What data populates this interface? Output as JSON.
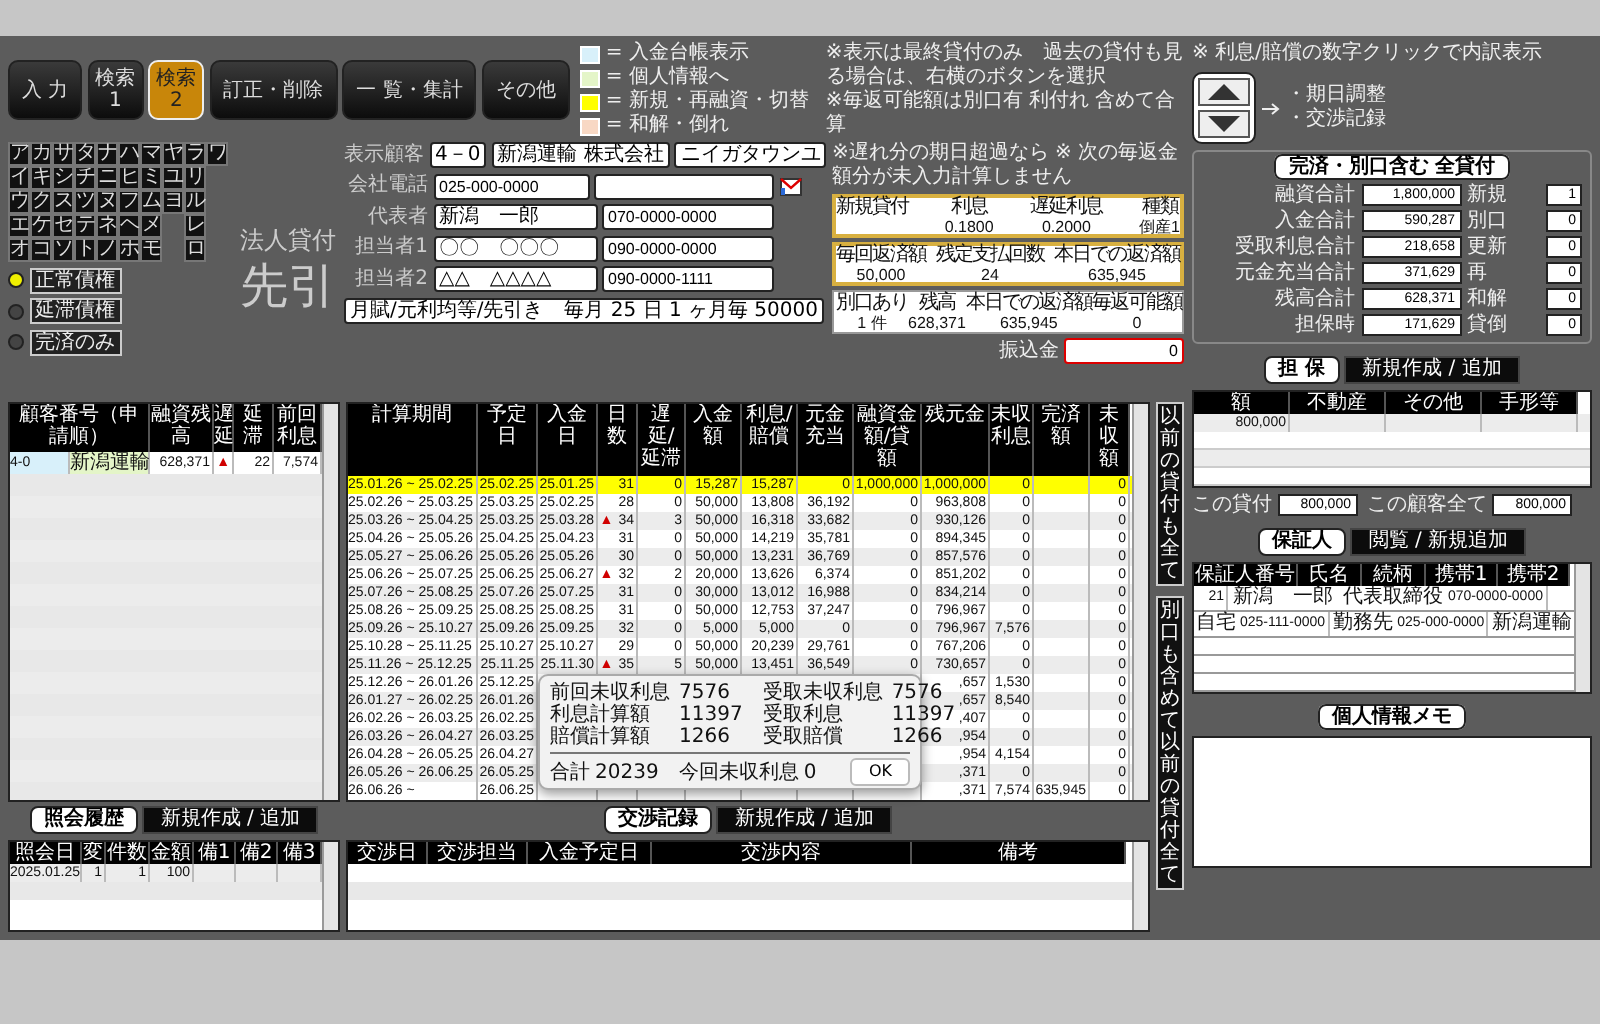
{
  "nav_buttons": [
    {
      "label": "入 力",
      "selected": false
    },
    {
      "label": "検索 1",
      "selected": false
    },
    {
      "label": "検索 2",
      "selected": true
    },
    {
      "label": "訂正・削除",
      "selected": false
    },
    {
      "label": "一 覧・集計",
      "selected": false
    },
    {
      "label": "その他",
      "selected": false
    }
  ],
  "legend": [
    {
      "color": "#d8f0fa",
      "label": "= 入金台帳表示"
    },
    {
      "color": "#e4f5c8",
      "label": "= 個人情報へ"
    },
    {
      "color": "#ffff00",
      "label": "= 新規・再融資・切替"
    },
    {
      "color": "#f8d8c4",
      "label": "= 和解・倒れ"
    }
  ],
  "notes": [
    "※表示は最終貸付のみ　過去の貸付も見る場合は、右横のボタンを選択",
    "※毎返可能額は別口有 利付れ 含めて合算"
  ],
  "detail_note": "※ 利息/賠償の数字クリックで内訳表示",
  "kana_columns": [
    [
      "ア",
      "イ",
      "ウ",
      "エ",
      "オ"
    ],
    [
      "カ",
      "キ",
      "ク",
      "ケ",
      "コ"
    ],
    [
      "サ",
      "シ",
      "ス",
      "セ",
      "ソ"
    ],
    [
      "タ",
      "チ",
      "ツ",
      "テ",
      "ト"
    ],
    [
      "ナ",
      "ニ",
      "ヌ",
      "ネ",
      "ノ"
    ],
    [
      "ハ",
      "ヒ",
      "フ",
      "ヘ",
      "ホ"
    ],
    [
      "マ",
      "ミ",
      "ム",
      "メ",
      "モ"
    ],
    [
      "ヤ",
      "ユ",
      "ヨ"
    ],
    [
      "ラ",
      "リ",
      "ル",
      "レ",
      "ロ"
    ],
    [
      "ワ"
    ]
  ],
  "status_filters": [
    {
      "label": "正常債権",
      "selected": true
    },
    {
      "label": "延滞債権",
      "selected": false
    },
    {
      "label": "完済のみ",
      "selected": false
    }
  ],
  "loan_type": "法人貸付",
  "loan_method": "先引",
  "customer": {
    "display_label": "表示顧客",
    "number": "4－0",
    "name": "新潟運輸 株式会社",
    "kana": "ニイガタウンユ",
    "phone_label": "会社電話",
    "company_phone": "025-000-0000",
    "contacts": [
      {
        "label": "代表者",
        "name": "新潟　一郎",
        "phone": "070-0000-0000"
      },
      {
        "label": "担当者1",
        "name": "〇〇　〇〇〇",
        "phone": "090-0000-0000"
      },
      {
        "label": "担当者2",
        "name": "△△　△△△△",
        "phone": "090-0000-1111"
      }
    ],
    "terms": "月賦/元利均等/先引き",
    "schedule": "毎月 25 日 1 ヶ月毎 50000"
  },
  "loan_info": {
    "note": "※遅れ分の期日超過なら ※ 次の毎返金額分が未入力計算しません",
    "boxes": [
      {
        "kind": "highlight",
        "cells": [
          {
            "label": "新規貸付"
          },
          {
            "label": "利息",
            "value": "0.1800"
          },
          {
            "label": "遅延利息",
            "value": "0.2000"
          },
          {
            "label": "種類",
            "value": "倒産1"
          }
        ]
      },
      {
        "kind": "highlight",
        "cells": [
          {
            "label": "毎回返済額",
            "value": "50,000"
          },
          {
            "label": "残定支払回数",
            "value": "24"
          },
          {
            "label": "本日での返済額",
            "value": "635,945"
          }
        ]
      },
      {
        "kind": "plain",
        "cells": [
          {
            "label": "別口あり",
            "value": "1 件"
          },
          {
            "label": "残高",
            "value": "628,371"
          },
          {
            "label": "本日での返済額",
            "value": "635,945"
          },
          {
            "label": "毎返可能額",
            "value": "0"
          }
        ]
      }
    ],
    "transfer": {
      "label": "振込金",
      "value": "0"
    }
  },
  "jump_links": [
    "・期日調整",
    "・交渉記録"
  ],
  "summary": {
    "title": "完済・別口含む 全貸付",
    "totals": [
      {
        "label": "融資合計",
        "value": "1,800,000"
      },
      {
        "label": "入金合計",
        "value": "590,287"
      },
      {
        "label": "受取利息合計",
        "value": "218,658"
      },
      {
        "label": "元金充当合計",
        "value": "371,629"
      },
      {
        "label": "残高合計",
        "value": "628,371"
      },
      {
        "label": "担保時",
        "value": "171,629"
      }
    ],
    "counts": [
      {
        "label": "新規",
        "value": "1"
      },
      {
        "label": "別口",
        "value": "0"
      },
      {
        "label": "更新",
        "value": "0"
      },
      {
        "label": "再",
        "value": "0"
      },
      {
        "label": "和解",
        "value": "0"
      },
      {
        "label": "貸倒",
        "value": "0"
      }
    ]
  },
  "customer_list": {
    "columns": [
      "顧客番号（申請順）",
      "融資残高",
      "遅延",
      "延滞",
      "前回利息"
    ],
    "rows": [
      {
        "number": "4-0",
        "name": "新潟運輸",
        "balance": "628,371",
        "late_mark": "▲",
        "late_days": "22",
        "last_interest": "7,574"
      }
    ]
  },
  "payments": {
    "columns": [
      "計算期間",
      "予定日",
      "入金日",
      "日数",
      "遅延/延滞",
      "入金額",
      "利息/賠償",
      "元金充当",
      "融資金額/貸額",
      "残元金",
      "未収利息",
      "完済額",
      "未収額"
    ],
    "rows": [
      {
        "highlight": true,
        "cells": [
          "25.01.26 ~ 25.02.25",
          "25.02.25",
          "25.01.25",
          "31",
          "0",
          "15,287",
          "15,287",
          "0",
          "1,000,000",
          "1,000,000",
          "0",
          null,
          "0"
        ]
      },
      {
        "highlight": false,
        "cells": [
          "25.02.26 ~ 25.03.25",
          "25.03.25",
          "25.02.25",
          "28",
          "0",
          "50,000",
          "13,808",
          "36,192",
          "0",
          "963,808",
          "0",
          null,
          "0"
        ]
      },
      {
        "highlight": false,
        "mark": "▲",
        "cells": [
          "25.03.26 ~ 25.04.25",
          "25.03.25",
          "25.03.28",
          "34",
          "3",
          "50,000",
          "16,318",
          "33,682",
          "0",
          "930,126",
          "0",
          null,
          "0"
        ]
      },
      {
        "highlight": false,
        "cells": [
          "25.04.26 ~ 25.05.26",
          "25.04.25",
          "25.04.23",
          "31",
          "0",
          "50,000",
          "14,219",
          "35,781",
          "0",
          "894,345",
          "0",
          null,
          "0"
        ]
      },
      {
        "highlight": false,
        "cells": [
          "25.05.27 ~ 25.06.26",
          "25.05.26",
          "25.05.26",
          "30",
          "0",
          "50,000",
          "13,231",
          "36,769",
          "0",
          "857,576",
          "0",
          null,
          "0"
        ]
      },
      {
        "highlight": false,
        "mark": "▲",
        "cells": [
          "25.06.26 ~ 25.07.25",
          "25.06.25",
          "25.06.27",
          "32",
          "2",
          "20,000",
          "13,626",
          "6,374",
          "0",
          "851,202",
          "0",
          null,
          "0"
        ]
      },
      {
        "highlight": false,
        "cells": [
          "25.07.26 ~ 25.08.25",
          "25.07.26",
          "25.07.25",
          "31",
          "0",
          "30,000",
          "13,012",
          "16,988",
          "0",
          "834,214",
          "0",
          null,
          "0"
        ]
      },
      {
        "highlight": false,
        "cells": [
          "25.08.26 ~ 25.09.25",
          "25.08.25",
          "25.08.25",
          "31",
          "0",
          "50,000",
          "12,753",
          "37,247",
          "0",
          "796,967",
          "0",
          null,
          "0"
        ]
      },
      {
        "highlight": false,
        "cells": [
          "25.09.26 ~ 25.10.27",
          "25.09.26",
          "25.09.25",
          "32",
          "0",
          "5,000",
          "5,000",
          "0",
          "0",
          "796,967",
          "7,576",
          null,
          "0"
        ]
      },
      {
        "highlight": false,
        "cells": [
          "25.10.28 ~ 25.11.25",
          "25.10.27",
          "25.10.27",
          "29",
          "0",
          "50,000",
          "20,239",
          "29,761",
          "0",
          "767,206",
          "0",
          null,
          "0"
        ]
      },
      {
        "highlight": false,
        "mark": "▲",
        "cells": [
          "25.11.26 ~ 25.12.25",
          "25.11.25",
          "25.11.30",
          "35",
          "5",
          "50,000",
          "13,451",
          "36,549",
          "0",
          "730,657",
          "0",
          null,
          "0"
        ]
      },
      {
        "highlight": false,
        "cells": [
          "25.12.26 ~ 26.01.26",
          "25.12.25",
          null,
          null,
          null,
          null,
          null,
          null,
          null,
          ",657",
          "1,530",
          null,
          "0"
        ]
      },
      {
        "highlight": false,
        "cells": [
          "26.01.27 ~ 26.02.25",
          "26.01.26",
          null,
          null,
          null,
          null,
          null,
          null,
          null,
          ",657",
          "8,540",
          null,
          "0"
        ]
      },
      {
        "highlight": false,
        "cells": [
          "26.02.26 ~ 26.03.25",
          "26.02.25",
          null,
          null,
          null,
          null,
          null,
          null,
          null,
          ",407",
          "0",
          null,
          "0"
        ]
      },
      {
        "highlight": false,
        "cells": [
          "26.03.26 ~ 26.04.27",
          "26.03.25",
          null,
          null,
          null,
          null,
          null,
          null,
          null,
          ",954",
          "0",
          null,
          "0"
        ]
      },
      {
        "highlight": false,
        "cells": [
          "26.04.28 ~ 26.05.25",
          "26.04.27",
          null,
          null,
          null,
          null,
          null,
          null,
          null,
          ",954",
          "4,154",
          null,
          "0"
        ]
      },
      {
        "highlight": false,
        "cells": [
          "26.05.26 ~ 26.06.25",
          "26.05.25",
          null,
          null,
          null,
          null,
          null,
          null,
          null,
          ",371",
          "0",
          null,
          "0"
        ]
      },
      {
        "highlight": false,
        "cells": [
          "26.06.26 ~",
          "26.06.25",
          null,
          null,
          null,
          null,
          null,
          null,
          null,
          ",371",
          "7,574",
          "635,945",
          "0"
        ]
      }
    ]
  },
  "dialog": {
    "groups": [
      [
        {
          "label": "前回未収利息",
          "value": "7576"
        },
        {
          "label": "利息計算額",
          "value": "11397"
        },
        {
          "label": "賠償計算額",
          "value": "1266"
        }
      ],
      [
        {
          "label": "受取未収利息",
          "value": "7576"
        },
        {
          "label": "受取利息",
          "value": "11397"
        },
        {
          "label": "受取賠償",
          "value": "1266"
        }
      ],
      [
        {
          "label": "合計",
          "value": "20239"
        }
      ],
      [
        {
          "label": "今回未収利息",
          "value": "0"
        }
      ]
    ],
    "ok": "OK"
  },
  "history_buttons": [
    "以前の貸付も全て",
    "別口も含めて以前の貸付全て"
  ],
  "inquiries": {
    "tab": "照会履歴",
    "action": "新規作成 / 追加",
    "columns": [
      "照会日",
      "変",
      "件数",
      "金額",
      "備1",
      "備2",
      "備3"
    ],
    "rows": [
      [
        "2025.01.25",
        "1",
        "1",
        "100",
        null,
        null,
        null
      ]
    ]
  },
  "negotiations": {
    "tab": "交渉記録",
    "action": "新規作成 / 追加",
    "columns": [
      "交渉日",
      "交渉担当",
      "入金予定日",
      "交渉内容",
      "備考"
    ]
  },
  "collateral": {
    "tab": "担 保",
    "action": "新規作成 / 追加",
    "columns": [
      "額",
      "不動産",
      "その他",
      "手形等"
    ],
    "rows": [
      [
        "800,000",
        null,
        null,
        null
      ]
    ],
    "this_loan_label": "この貸付",
    "this_loan": "800,000",
    "customer_total_label": "この顧客全て",
    "customer_total": "800,000"
  },
  "guarantors": {
    "tab": "保証人",
    "action": "閲覧 / 新規追加",
    "columns": [
      "保証人番号",
      "氏名",
      "続柄",
      "携帯1",
      "携帯2"
    ],
    "rows": [
      {
        "number": "21",
        "name": "新潟　一郎",
        "relation": "代表取締役",
        "mobile1": "070-0000-0000",
        "home_label": "自宅",
        "home": "025-111-0000",
        "work_label": "勤務先",
        "work": "025-000-0000",
        "employer": "新潟運輸"
      }
    ]
  },
  "memo": {
    "title": "個人情報メモ"
  }
}
